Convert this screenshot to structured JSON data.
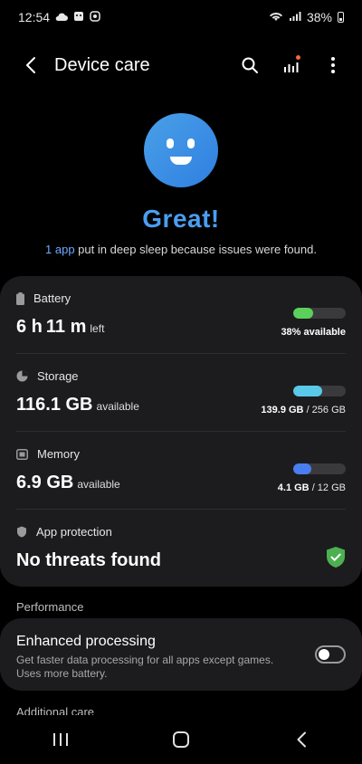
{
  "status": {
    "time": "12:54",
    "battery_percent": "38%"
  },
  "header": {
    "title": "Device care"
  },
  "hero": {
    "title": "Great!",
    "sub_link": "1 app",
    "sub_text": " put in deep sleep because issues were found."
  },
  "battery": {
    "label": "Battery",
    "hours": "6 h",
    "minutes": "11 m",
    "suffix": "left",
    "meter_text": "38% available",
    "level": 0.38,
    "color": "#5bd05a"
  },
  "storage": {
    "label": "Storage",
    "value": "116.1 GB",
    "suffix": "available",
    "used": "139.9 GB",
    "total": " / 256 GB",
    "level": 0.55,
    "color": "#5ac8e8"
  },
  "memory": {
    "label": "Memory",
    "value": "6.9 GB",
    "suffix": "available",
    "used": "4.1 GB",
    "total": " / 12 GB",
    "level": 0.34,
    "color": "#4a7ef0"
  },
  "protection": {
    "label": "App protection",
    "value": "No threats found",
    "color": "#4caf50"
  },
  "performance": {
    "section": "Performance",
    "title": "Enhanced processing",
    "desc": "Get faster data processing for all apps except games. Uses more battery.",
    "enabled": false
  },
  "additional": {
    "section": "Additional care"
  }
}
